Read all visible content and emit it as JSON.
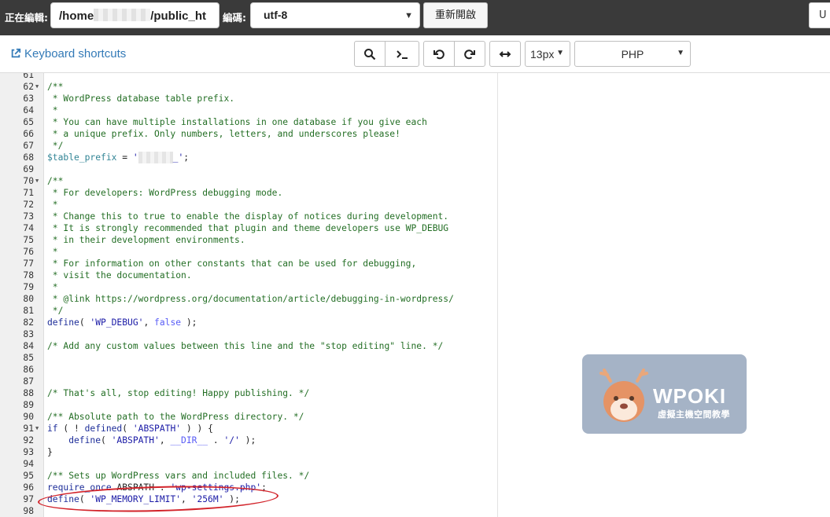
{
  "topbar": {
    "editing_label": "正在編輯:",
    "path_prefix": "/home",
    "path_suffix": "/public_ht",
    "encoding_label": "編碼:",
    "encoding_value": "utf-8",
    "reopen_button": "重新開啟",
    "right_button": "U"
  },
  "toolbar": {
    "keyboard_shortcuts": "Keyboard shortcuts",
    "font_size": "13px",
    "language": "PHP"
  },
  "code_lines": [
    {
      "n": "61",
      "fold": false,
      "parts": []
    },
    {
      "n": "62",
      "fold": true,
      "parts": [
        {
          "t": "/**",
          "k": "c"
        }
      ]
    },
    {
      "n": "63",
      "fold": false,
      "parts": [
        {
          "t": " * WordPress database table prefix.",
          "k": "c"
        }
      ]
    },
    {
      "n": "64",
      "fold": false,
      "parts": [
        {
          "t": " *",
          "k": "c"
        }
      ]
    },
    {
      "n": "65",
      "fold": false,
      "parts": [
        {
          "t": " * You can have multiple installations in one database if you give each",
          "k": "c"
        }
      ]
    },
    {
      "n": "66",
      "fold": false,
      "parts": [
        {
          "t": " * a unique prefix. Only numbers, letters, and underscores please!",
          "k": "c"
        }
      ]
    },
    {
      "n": "67",
      "fold": false,
      "parts": [
        {
          "t": " */",
          "k": "c"
        }
      ]
    },
    {
      "n": "68",
      "fold": false,
      "parts": [
        {
          "t": "$table_prefix",
          "k": "v"
        },
        {
          "t": " = ",
          "k": "pn"
        },
        {
          "t": "'",
          "k": "s"
        },
        {
          "t": "",
          "k": "mask"
        },
        {
          "t": "_'",
          "k": "s"
        },
        {
          "t": ";",
          "k": "pn"
        }
      ]
    },
    {
      "n": "69",
      "fold": false,
      "parts": []
    },
    {
      "n": "70",
      "fold": true,
      "parts": [
        {
          "t": "/**",
          "k": "c"
        }
      ]
    },
    {
      "n": "71",
      "fold": false,
      "parts": [
        {
          "t": " * For developers: WordPress debugging mode.",
          "k": "c"
        }
      ]
    },
    {
      "n": "72",
      "fold": false,
      "parts": [
        {
          "t": " *",
          "k": "c"
        }
      ]
    },
    {
      "n": "73",
      "fold": false,
      "parts": [
        {
          "t": " * Change this to true to enable the display of notices during development.",
          "k": "c"
        }
      ]
    },
    {
      "n": "74",
      "fold": false,
      "parts": [
        {
          "t": " * It is strongly recommended that plugin and theme developers use WP_DEBUG",
          "k": "c"
        }
      ]
    },
    {
      "n": "75",
      "fold": false,
      "parts": [
        {
          "t": " * in their development environments.",
          "k": "c"
        }
      ]
    },
    {
      "n": "76",
      "fold": false,
      "parts": [
        {
          "t": " *",
          "k": "c"
        }
      ]
    },
    {
      "n": "77",
      "fold": false,
      "parts": [
        {
          "t": " * For information on other constants that can be used for debugging,",
          "k": "c"
        }
      ]
    },
    {
      "n": "78",
      "fold": false,
      "parts": [
        {
          "t": " * visit the documentation.",
          "k": "c"
        }
      ]
    },
    {
      "n": "79",
      "fold": false,
      "parts": [
        {
          "t": " *",
          "k": "c"
        }
      ]
    },
    {
      "n": "80",
      "fold": false,
      "parts": [
        {
          "t": " * @link https://wordpress.org/documentation/article/debugging-in-wordpress/",
          "k": "c"
        }
      ]
    },
    {
      "n": "81",
      "fold": false,
      "parts": [
        {
          "t": " */",
          "k": "c"
        }
      ]
    },
    {
      "n": "82",
      "fold": false,
      "parts": [
        {
          "t": "define",
          "k": "kw"
        },
        {
          "t": "( ",
          "k": "pn"
        },
        {
          "t": "'WP_DEBUG'",
          "k": "s"
        },
        {
          "t": ", ",
          "k": "pn"
        },
        {
          "t": "false",
          "k": "bool"
        },
        {
          "t": " );",
          "k": "pn"
        }
      ]
    },
    {
      "n": "83",
      "fold": false,
      "parts": []
    },
    {
      "n": "84",
      "fold": false,
      "parts": [
        {
          "t": "/* Add any custom values between this line and the \"stop editing\" line. */",
          "k": "c"
        }
      ]
    },
    {
      "n": "85",
      "fold": false,
      "parts": []
    },
    {
      "n": "86",
      "fold": false,
      "parts": []
    },
    {
      "n": "87",
      "fold": false,
      "parts": []
    },
    {
      "n": "88",
      "fold": false,
      "parts": [
        {
          "t": "/* That's all, stop editing! Happy publishing. */",
          "k": "c"
        }
      ]
    },
    {
      "n": "89",
      "fold": false,
      "parts": []
    },
    {
      "n": "90",
      "fold": false,
      "parts": [
        {
          "t": "/** Absolute path to the WordPress directory. */",
          "k": "c"
        }
      ]
    },
    {
      "n": "91",
      "fold": true,
      "parts": [
        {
          "t": "if",
          "k": "kw"
        },
        {
          "t": " ( ! ",
          "k": "pn"
        },
        {
          "t": "defined",
          "k": "kw"
        },
        {
          "t": "( ",
          "k": "pn"
        },
        {
          "t": "'ABSPATH'",
          "k": "s"
        },
        {
          "t": " ) ) {",
          "k": "pn"
        }
      ]
    },
    {
      "n": "92",
      "fold": false,
      "parts": [
        {
          "t": "    define",
          "k": "kw"
        },
        {
          "t": "( ",
          "k": "pn"
        },
        {
          "t": "'ABSPATH'",
          "k": "s"
        },
        {
          "t": ", ",
          "k": "pn"
        },
        {
          "t": "__DIR__",
          "k": "bool"
        },
        {
          "t": " . ",
          "k": "pn"
        },
        {
          "t": "'/'",
          "k": "s"
        },
        {
          "t": " );",
          "k": "pn"
        }
      ]
    },
    {
      "n": "93",
      "fold": false,
      "parts": [
        {
          "t": "}",
          "k": "pn"
        }
      ]
    },
    {
      "n": "94",
      "fold": false,
      "parts": []
    },
    {
      "n": "95",
      "fold": false,
      "parts": [
        {
          "t": "/** Sets up WordPress vars and included files. */",
          "k": "c"
        }
      ]
    },
    {
      "n": "96",
      "fold": false,
      "parts": [
        {
          "t": "require_once",
          "k": "kw"
        },
        {
          "t": " ABSPATH . ",
          "k": "pn"
        },
        {
          "t": "'wp-settings.php'",
          "k": "s"
        },
        {
          "t": ";",
          "k": "pn"
        }
      ]
    },
    {
      "n": "97",
      "fold": false,
      "parts": [
        {
          "t": "define",
          "k": "kw"
        },
        {
          "t": "( ",
          "k": "pn"
        },
        {
          "t": "'WP_MEMORY_LIMIT'",
          "k": "s"
        },
        {
          "t": ", ",
          "k": "pn"
        },
        {
          "t": "'256M'",
          "k": "s"
        },
        {
          "t": " );",
          "k": "pn"
        }
      ]
    },
    {
      "n": "98",
      "fold": false,
      "parts": []
    }
  ],
  "watermark": {
    "brand": "WPOKI",
    "subtitle": "虛擬主機空間教學"
  },
  "colors": {
    "topbar_bg": "#3a3a3a",
    "link": "#337ab7",
    "comment": "#236e24",
    "annotation_ring": "#d2232a",
    "watermark_bg": "#9eadc2"
  }
}
